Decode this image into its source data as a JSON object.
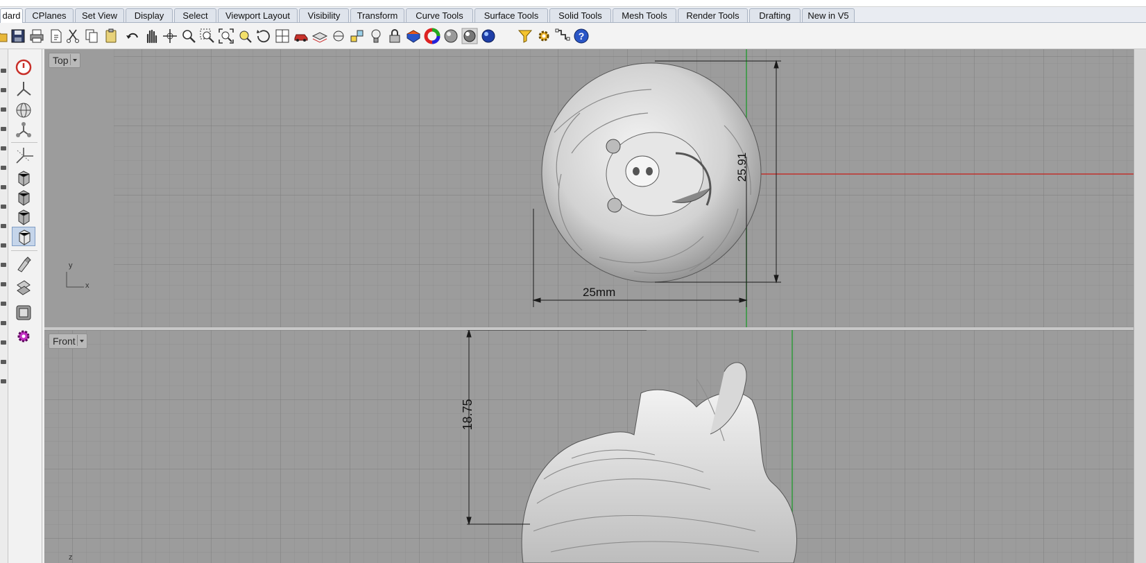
{
  "tabs": [
    {
      "label": "dard",
      "active": true
    },
    {
      "label": "CPlanes",
      "active": false
    },
    {
      "label": "Set View",
      "active": false
    },
    {
      "label": "Display",
      "active": false
    },
    {
      "label": "Select",
      "active": false
    },
    {
      "label": "Viewport Layout",
      "active": false
    },
    {
      "label": "Visibility",
      "active": false
    },
    {
      "label": "Transform",
      "active": false
    },
    {
      "label": "Curve Tools",
      "active": false
    },
    {
      "label": "Surface Tools",
      "active": false
    },
    {
      "label": "Solid Tools",
      "active": false
    },
    {
      "label": "Mesh Tools",
      "active": false
    },
    {
      "label": "Render Tools",
      "active": false
    },
    {
      "label": "Drafting",
      "active": false
    },
    {
      "label": "New in V5",
      "active": false
    }
  ],
  "toolbar": {
    "icons": [
      "open-icon",
      "save-icon",
      "print-icon",
      "import-icon",
      "cut-icon",
      "copy-icon",
      "paste-icon",
      "undo-icon",
      "pan-hand-icon",
      "move-view-icon",
      "zoom-icon",
      "zoom-window-icon",
      "zoom-extents-icon",
      "zoom-selected-icon",
      "rotate-view-icon",
      "viewport-layout-icon",
      "car-icon",
      "layer-icon",
      "properties-icon",
      "object-snap-icon",
      "light-bulb-icon",
      "lock-icon",
      "material-icon",
      "color-wheel-icon",
      "shaded-sphere-icon",
      "rendered-sphere-icon",
      "ghosted-sphere-icon",
      "blue-sphere-icon",
      "filter-icon",
      "gear-options-icon",
      "grid-snap-icon",
      "help-icon"
    ]
  },
  "palette": {
    "tools": [
      "stop-icon",
      "axis-icon",
      "globe-icon",
      "network-icon",
      "gumball-icon",
      "box-front-icon",
      "box-right-icon",
      "box-top-icon",
      "box-perspective-icon",
      "brush-icon",
      "loft-icon",
      "solid-icon",
      "plugin-gear-icon"
    ]
  },
  "viewports": {
    "top": {
      "label": "Top",
      "dim_width": "25mm",
      "dim_height": "25.91",
      "axis_x": "x",
      "axis_y": "y"
    },
    "front": {
      "label": "Front",
      "dim_height": "18.75",
      "axis_z": "z"
    }
  },
  "colors": {
    "viewport_bg": "#9c9c9c",
    "grid_minor": "#8f8f8f",
    "grid_major": "#7c7c7c",
    "x_axis": "#c0302c",
    "y_axis": "#2e9a3a"
  }
}
